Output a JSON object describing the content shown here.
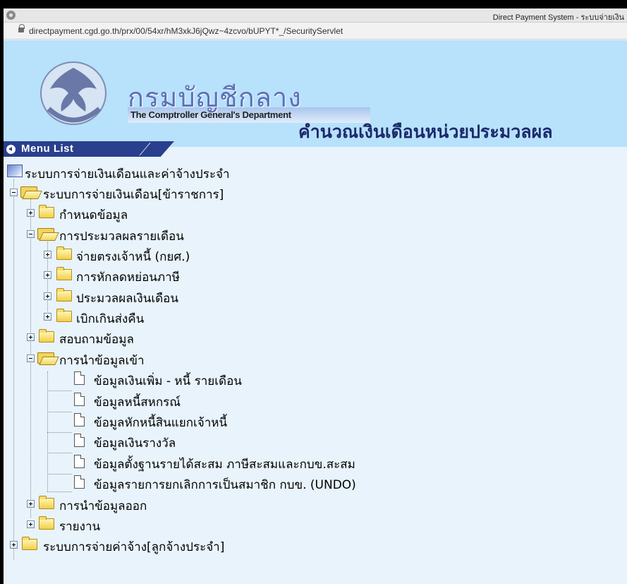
{
  "window": {
    "title": "Direct Payment System - ระบบจ่ายเงิน",
    "url": "directpayment.cgd.go.th/prx/00/54xr/hM3xkJ6jQwz~4zcvo/bUPYT*_/SecurityServlet"
  },
  "header": {
    "dept_thai": "กรมบัญชีกลาง",
    "dept_english": "The Comptroller General's Department",
    "page_heading": "คำนวณเงินเดือนหน่วยประมวลผล",
    "seal_text": "กรมบัญชีกลาง"
  },
  "menu": {
    "title": "Menu List"
  },
  "tree": {
    "root": "ระบบการจ่ายเงินเดือนและค่าจ้างประจำ",
    "civil": "ระบบการจ่ายเงินเดือน[ข้าราชการ]",
    "define": "กำหนดข้อมูล",
    "monthly": "การประมวลผลรายเดือน",
    "direct_pay": "จ่ายตรงเจ้าหนี้ (กยศ.)",
    "tax": "การหักลดหย่อนภาษี",
    "salary_proc": "ประมวลผลเงินเดือน",
    "overpay": "เบิกเกินส่งคืน",
    "inquiry": "สอบถามข้อมูล",
    "import": "การนำข้อมูลเข้า",
    "import_items": [
      "ข้อมูลเงินเพิ่ม - หนี้ รายเดือน",
      "ข้อมูลหนี้สหกรณ์",
      "ข้อมูลหักหนี้สินแยกเจ้าหนี้",
      "ข้อมูลเงินรางวัล",
      "ข้อมูลตั้งฐานรายได้สะสม ภาษีสะสมและกบข.สะสม",
      "ข้อมูลรายการยกเลิกการเป็นสมาชิก กบข. (UNDO)"
    ],
    "export": "การนำข้อมูลออก",
    "report": "รายงาน",
    "employee": "ระบบการจ่ายค่าจ้าง[ลูกจ้างประจำ]"
  }
}
